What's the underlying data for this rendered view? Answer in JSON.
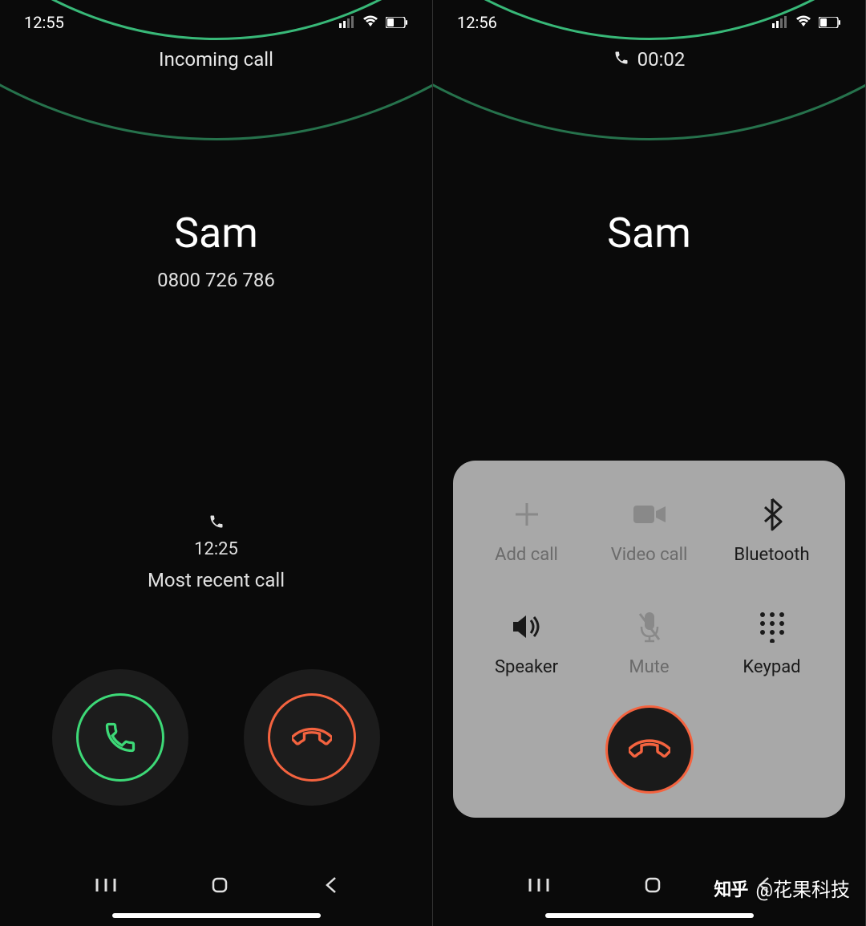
{
  "left": {
    "statusTime": "12:55",
    "header": "Incoming call",
    "callerName": "Sam",
    "callerNumber": "0800 726 786",
    "recentTime": "12:25",
    "recentLabel": "Most recent call"
  },
  "right": {
    "statusTime": "12:56",
    "callDuration": "00:02",
    "callerName": "Sam",
    "controls": {
      "addCall": "Add call",
      "videoCall": "Video call",
      "bluetooth": "Bluetooth",
      "speaker": "Speaker",
      "mute": "Mute",
      "keypad": "Keypad"
    }
  },
  "watermark": {
    "logo": "知乎",
    "text": "@花果科技"
  }
}
